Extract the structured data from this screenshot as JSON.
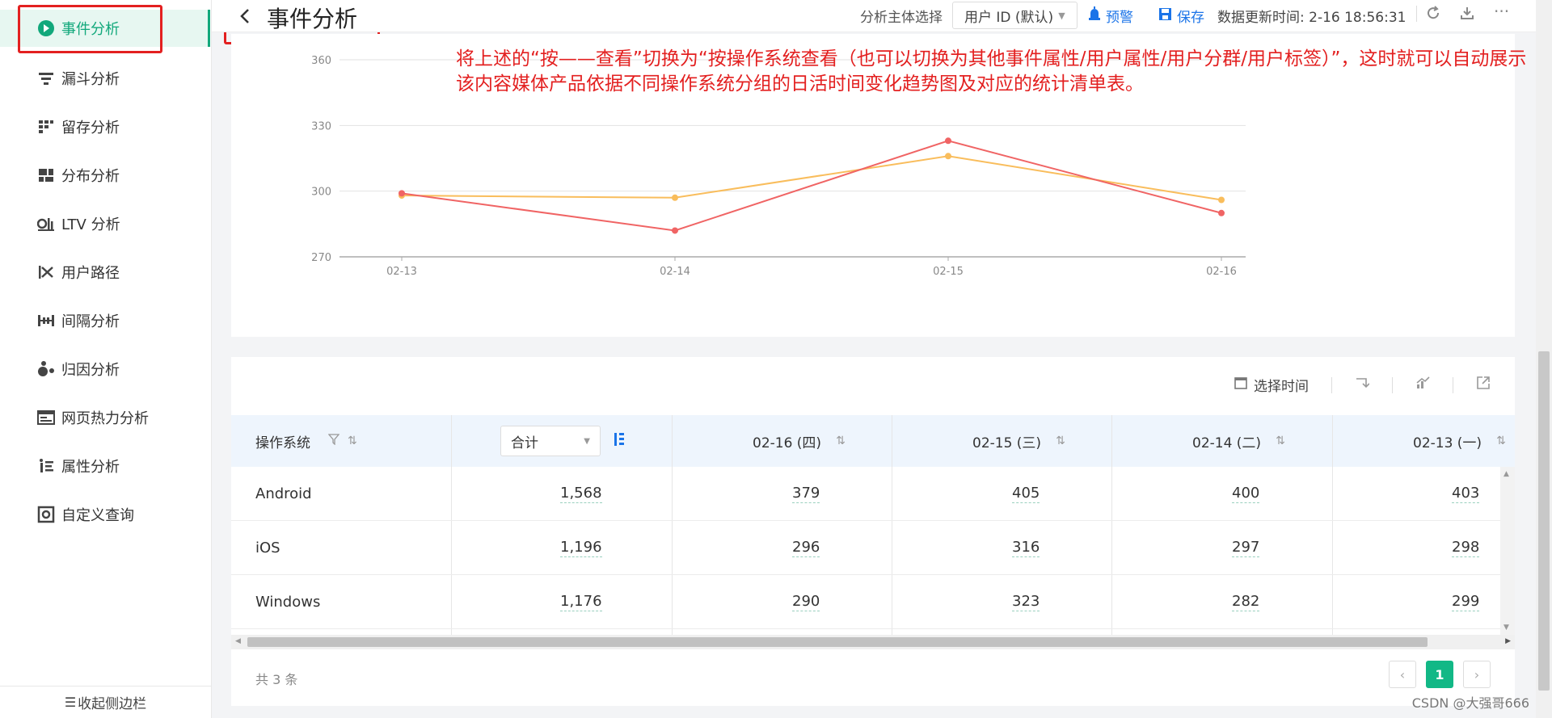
{
  "sidebar": {
    "items": [
      {
        "label": "事件分析",
        "icon": "event-analysis-icon"
      },
      {
        "label": "漏斗分析",
        "icon": "funnel-icon"
      },
      {
        "label": "留存分析",
        "icon": "retention-icon"
      },
      {
        "label": "分布分析",
        "icon": "distribution-icon"
      },
      {
        "label": "LTV 分析",
        "icon": "ltv-icon"
      },
      {
        "label": "用户路径",
        "icon": "user-path-icon"
      },
      {
        "label": "间隔分析",
        "icon": "interval-icon"
      },
      {
        "label": "归因分析",
        "icon": "attribution-icon"
      },
      {
        "label": "网页热力分析",
        "icon": "heatmap-icon"
      },
      {
        "label": "属性分析",
        "icon": "attribute-icon"
      },
      {
        "label": "自定义查询",
        "icon": "custom-query-icon"
      }
    ],
    "collapse_label": "收起侧边栏"
  },
  "header": {
    "title": "事件分析",
    "subject_label": "分析主体选择",
    "subject_value": "用户 ID (默认)",
    "alert_label": "预警",
    "save_label": "保存",
    "update_time": "数据更新时间: 2-16 18:56:31"
  },
  "annotation": "将上述的“按——查看”切换为“按操作系统查看（也可以切换为其他事件属性/用户属性/用户分群/用户标签）”，这时就可以自动展示该内容媒体产品依据不同操作系统分组的日活时间变化趋势图及对应的统计清单表。",
  "chart_data": {
    "type": "line",
    "x": [
      "02-13",
      "02-14",
      "02-15",
      "02-16"
    ],
    "ylim": [
      270,
      360
    ],
    "yticks": [
      "270",
      "300",
      "330",
      "360"
    ],
    "grid": true,
    "series": [
      {
        "values": [
          299,
          282,
          323,
          290
        ],
        "color": "#f06464"
      },
      {
        "values": [
          298,
          297,
          316,
          296
        ],
        "color": "#f9bd5c"
      }
    ]
  },
  "table": {
    "toolbar": {
      "time_label": "选择时间"
    },
    "headers": [
      "操作系统",
      "合计",
      "02-16 (四)",
      "02-15 (三)",
      "02-14 (二)",
      "02-13 (一)"
    ],
    "rows": [
      {
        "os": "Android",
        "values": [
          "1,568",
          "379",
          "405",
          "400",
          "403"
        ]
      },
      {
        "os": "iOS",
        "values": [
          "1,196",
          "296",
          "316",
          "297",
          "298"
        ]
      },
      {
        "os": "Windows",
        "values": [
          "1,176",
          "290",
          "323",
          "282",
          "299"
        ]
      }
    ],
    "total": "共 3 条",
    "current_page": "1"
  },
  "watermark": "CSDN @大强哥666"
}
